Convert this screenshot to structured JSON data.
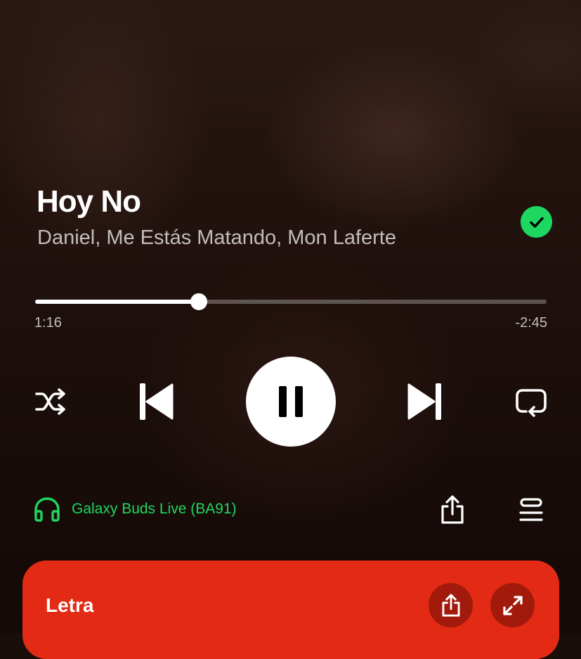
{
  "track": {
    "title": "Hoy No",
    "artist": "Daniel, Me Estás Matando, Mon Laferte",
    "saved": true
  },
  "playback": {
    "elapsed": "1:16",
    "remaining": "-2:45",
    "progress_fraction": 0.32,
    "state": "playing"
  },
  "controls": {
    "shuffle_icon": "shuffle-icon",
    "previous_icon": "skip-previous-icon",
    "pause_icon": "pause-icon",
    "next_icon": "skip-next-icon",
    "repeat_icon": "repeat-icon"
  },
  "device": {
    "name": "Galaxy Buds Live (BA91)",
    "icon": "headphones-icon"
  },
  "actions": {
    "share_icon": "share-icon",
    "queue_icon": "queue-icon"
  },
  "lyrics": {
    "title": "Letra",
    "share_icon": "share-icon",
    "expand_icon": "expand-icon"
  },
  "colors": {
    "accent_green": "#1ed760",
    "lyrics_card": "#e22a14",
    "background": "#1a0e0b"
  }
}
